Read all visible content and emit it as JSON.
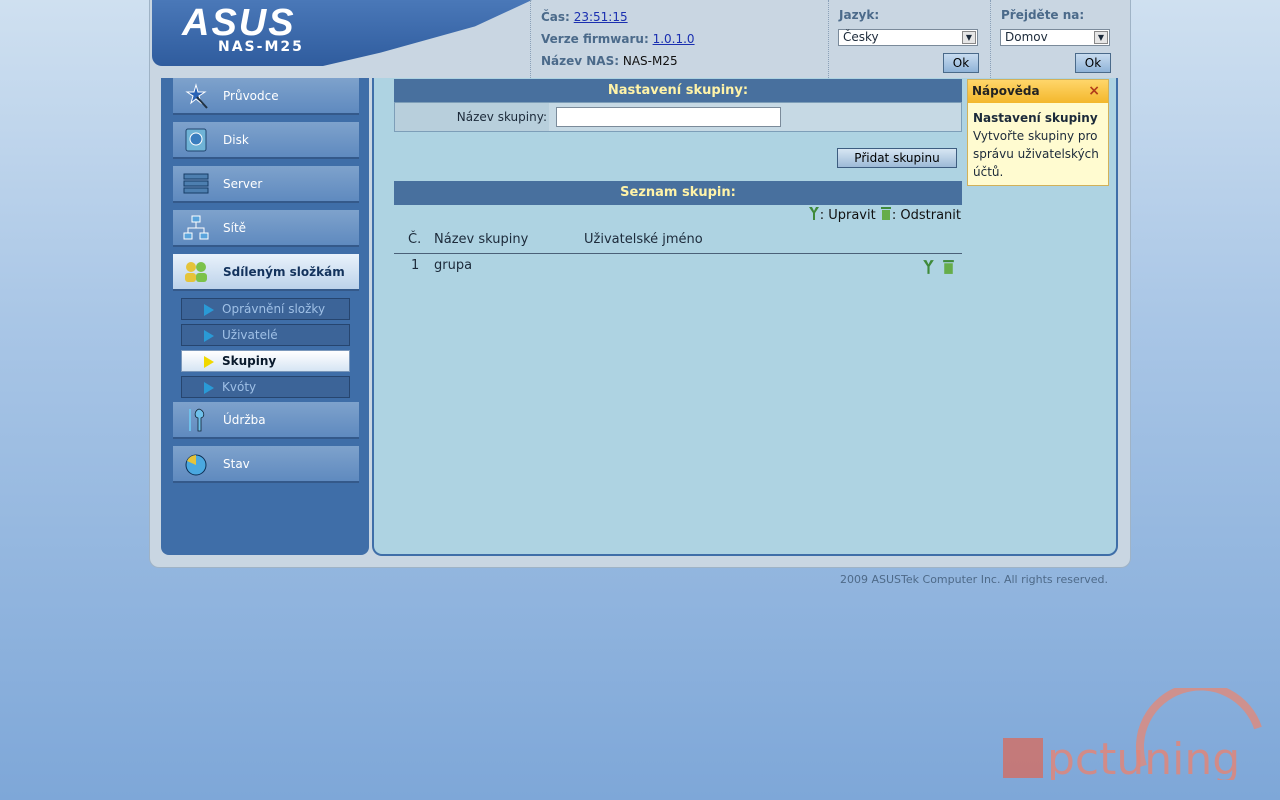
{
  "header": {
    "brand": "ASUS",
    "model": "NAS-M25",
    "time_label": "Čas:",
    "time_value": "23:51:15",
    "firmware_label": "Verze firmwaru:",
    "firmware_value": "1.0.1.0",
    "nas_name_label": "Název NAS:",
    "nas_name_value": "NAS-M25",
    "language_label": "Jazyk:",
    "language_value": "Česky",
    "language_ok": "Ok",
    "goto_label": "Přejděte na:",
    "goto_value": "Domov",
    "goto_ok": "Ok"
  },
  "sidebar": {
    "items": [
      {
        "label": "Průvodce",
        "icon": "wand-icon"
      },
      {
        "label": "Disk",
        "icon": "disk-icon"
      },
      {
        "label": "Server",
        "icon": "server-icon"
      },
      {
        "label": "Sítě",
        "icon": "network-icon"
      },
      {
        "label": "Sdíleným složkám",
        "icon": "users-icon"
      },
      {
        "label": "Údržba",
        "icon": "tools-icon"
      },
      {
        "label": "Stav",
        "icon": "status-icon"
      }
    ],
    "subitems": [
      {
        "label": "Oprávnění složky"
      },
      {
        "label": "Uživatelé"
      },
      {
        "label": "Skupiny"
      },
      {
        "label": "Kvóty"
      }
    ]
  },
  "main": {
    "settings_title": "Nastavení skupiny:",
    "group_name_label": "Název skupiny:",
    "group_name_value": "",
    "add_button": "Přidat skupinu",
    "list_title": "Seznam skupin:",
    "legend_edit": ": Upravit",
    "legend_delete": ": Odstranit",
    "columns": [
      "Č.",
      "Název skupiny",
      "Uživatelské jméno"
    ],
    "rows": [
      {
        "num": "1",
        "name": "grupa",
        "users": ""
      }
    ]
  },
  "help": {
    "title": "Nápověda",
    "close": "×",
    "heading": "Nastavení skupiny",
    "text": "Vytvořte skupiny pro správu uživatelských účtů."
  },
  "footer": {
    "copyright": "2009 ASUSTek Computer Inc. All rights reserved."
  },
  "watermark": "pctuning",
  "colors": {
    "accent": "#48709e",
    "title_text": "#fff3a8",
    "help_header": "#f3b72c",
    "icon_green": "#3f8a3a"
  }
}
